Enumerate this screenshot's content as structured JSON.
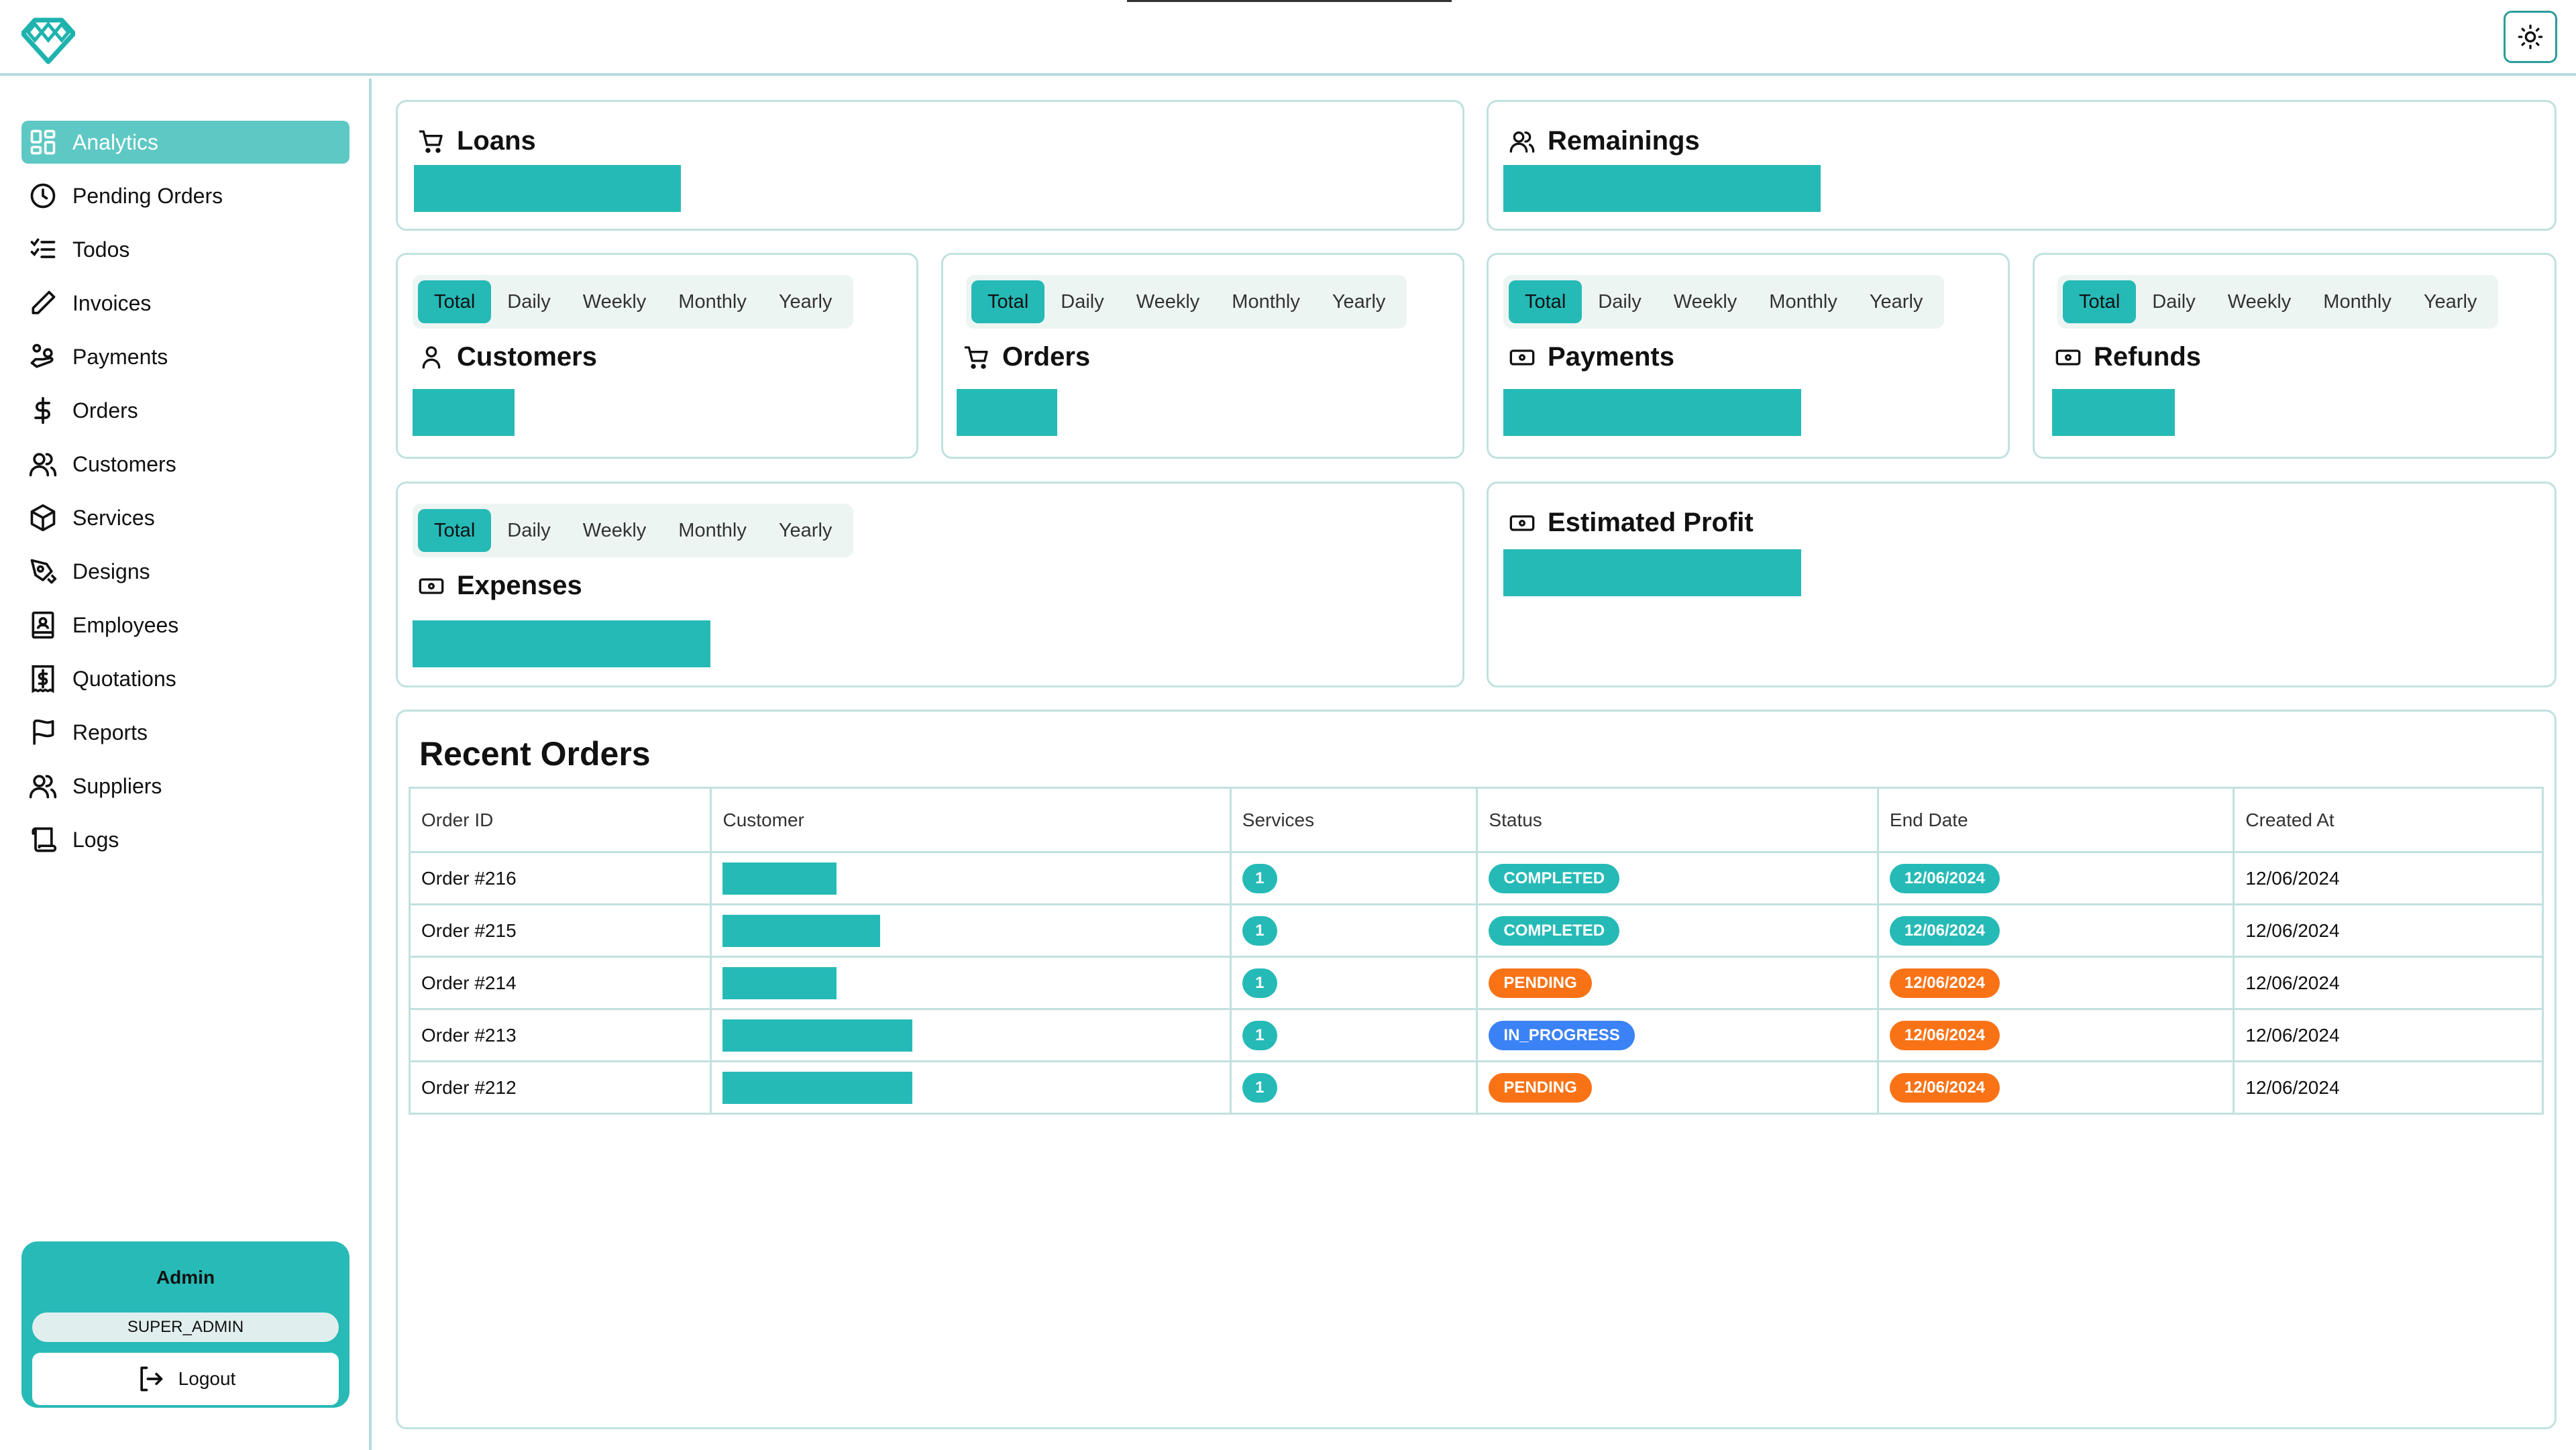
{
  "colors": {
    "accent": "#26bab7",
    "accent_light": "#5ec8c4",
    "border": "#c1e1e0",
    "completed": "#26bab7",
    "pending": "#f97316",
    "in_progress": "#3b82f6"
  },
  "header": {
    "logo_icon": "diamond-logo-icon",
    "theme_toggle_icon": "sun-icon"
  },
  "sidebar": {
    "items": [
      {
        "label": "Analytics",
        "icon": "dashboard-grid-icon",
        "active": true
      },
      {
        "label": "Pending Orders",
        "icon": "clock-icon"
      },
      {
        "label": "Todos",
        "icon": "checklist-icon"
      },
      {
        "label": "Invoices",
        "icon": "pencil-icon"
      },
      {
        "label": "Payments",
        "icon": "hand-coins-icon"
      },
      {
        "label": "Orders",
        "icon": "dollar-icon"
      },
      {
        "label": "Customers",
        "icon": "users-icon"
      },
      {
        "label": "Services",
        "icon": "box-icon"
      },
      {
        "label": "Designs",
        "icon": "pen-tool-icon"
      },
      {
        "label": "Employees",
        "icon": "contact-book-icon"
      },
      {
        "label": "Quotations",
        "icon": "receipt-icon"
      },
      {
        "label": "Reports",
        "icon": "flag-icon"
      },
      {
        "label": "Suppliers",
        "icon": "users-icon"
      },
      {
        "label": "Logs",
        "icon": "scroll-icon"
      }
    ],
    "user": {
      "name": "Admin",
      "role": "SUPER_ADMIN",
      "logout_label": "Logout"
    }
  },
  "period_tabs": [
    "Total",
    "Daily",
    "Weekly",
    "Monthly",
    "Yearly"
  ],
  "period_selected": "Total",
  "cards": {
    "loans": {
      "title": "Loans",
      "icon": "cart-icon"
    },
    "remainings": {
      "title": "Remainings",
      "icon": "users-icon"
    },
    "customers": {
      "title": "Customers",
      "icon": "user-icon"
    },
    "orders": {
      "title": "Orders",
      "icon": "cart-icon"
    },
    "payments": {
      "title": "Payments",
      "icon": "banknote-icon"
    },
    "refunds": {
      "title": "Refunds",
      "icon": "banknote-icon"
    },
    "expenses": {
      "title": "Expenses",
      "icon": "banknote-icon"
    },
    "estimated_profit": {
      "title": "Estimated Profit",
      "icon": "banknote-icon"
    }
  },
  "recent_orders": {
    "title": "Recent Orders",
    "columns": [
      "Order ID",
      "Customer",
      "Services",
      "Status",
      "End Date",
      "Created At"
    ],
    "rows": [
      {
        "order_id": "Order #216",
        "services": "1",
        "status": "COMPLETED",
        "end_date": "12/06/2024",
        "end_date_status": "completed",
        "created_at": "12/06/2024"
      },
      {
        "order_id": "Order #215",
        "services": "1",
        "status": "COMPLETED",
        "end_date": "12/06/2024",
        "end_date_status": "completed",
        "created_at": "12/06/2024"
      },
      {
        "order_id": "Order #214",
        "services": "1",
        "status": "PENDING",
        "end_date": "12/06/2024",
        "end_date_status": "pending",
        "created_at": "12/06/2024"
      },
      {
        "order_id": "Order #213",
        "services": "1",
        "status": "IN_PROGRESS",
        "end_date": "12/06/2024",
        "end_date_status": "pending",
        "created_at": "12/06/2024"
      },
      {
        "order_id": "Order #212",
        "services": "1",
        "status": "PENDING",
        "end_date": "12/06/2024",
        "end_date_status": "pending",
        "created_at": "12/06/2024"
      }
    ]
  }
}
